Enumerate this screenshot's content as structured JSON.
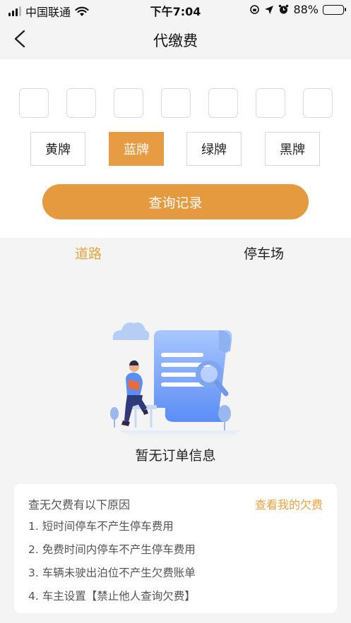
{
  "status_bar": {
    "carrier": "中国联通",
    "time": "下午7:04",
    "battery": "88%"
  },
  "nav": {
    "back_icon": "chevron-left-icon",
    "title": "代缴费"
  },
  "plate_slot_count": 7,
  "plate_colors": [
    {
      "label": "黄牌",
      "selected": false
    },
    {
      "label": "蓝牌",
      "selected": true
    },
    {
      "label": "绿牌",
      "selected": false
    },
    {
      "label": "黑牌",
      "selected": false
    }
  ],
  "query_button": "查询记录",
  "tabs": [
    {
      "label": "道路",
      "active": true
    },
    {
      "label": "停车场",
      "active": false
    }
  ],
  "empty_state": {
    "illustration": "empty-document-illustration",
    "text": "暂无订单信息"
  },
  "reasons_card": {
    "title": "查无欠费有以下原因",
    "link": "查看我的欠费",
    "items": [
      "1. 短时间停车不产生停车费用",
      "2. 免费时间内停车不产生停车费用",
      "3. 车辆未驶出泊位不产生欠费账单",
      "4. 车主设置【禁止他人查询欠费】"
    ]
  },
  "colors": {
    "accent": "#e69a40",
    "tab_active": "#e8a240",
    "page_bg": "#f4f4f4"
  }
}
